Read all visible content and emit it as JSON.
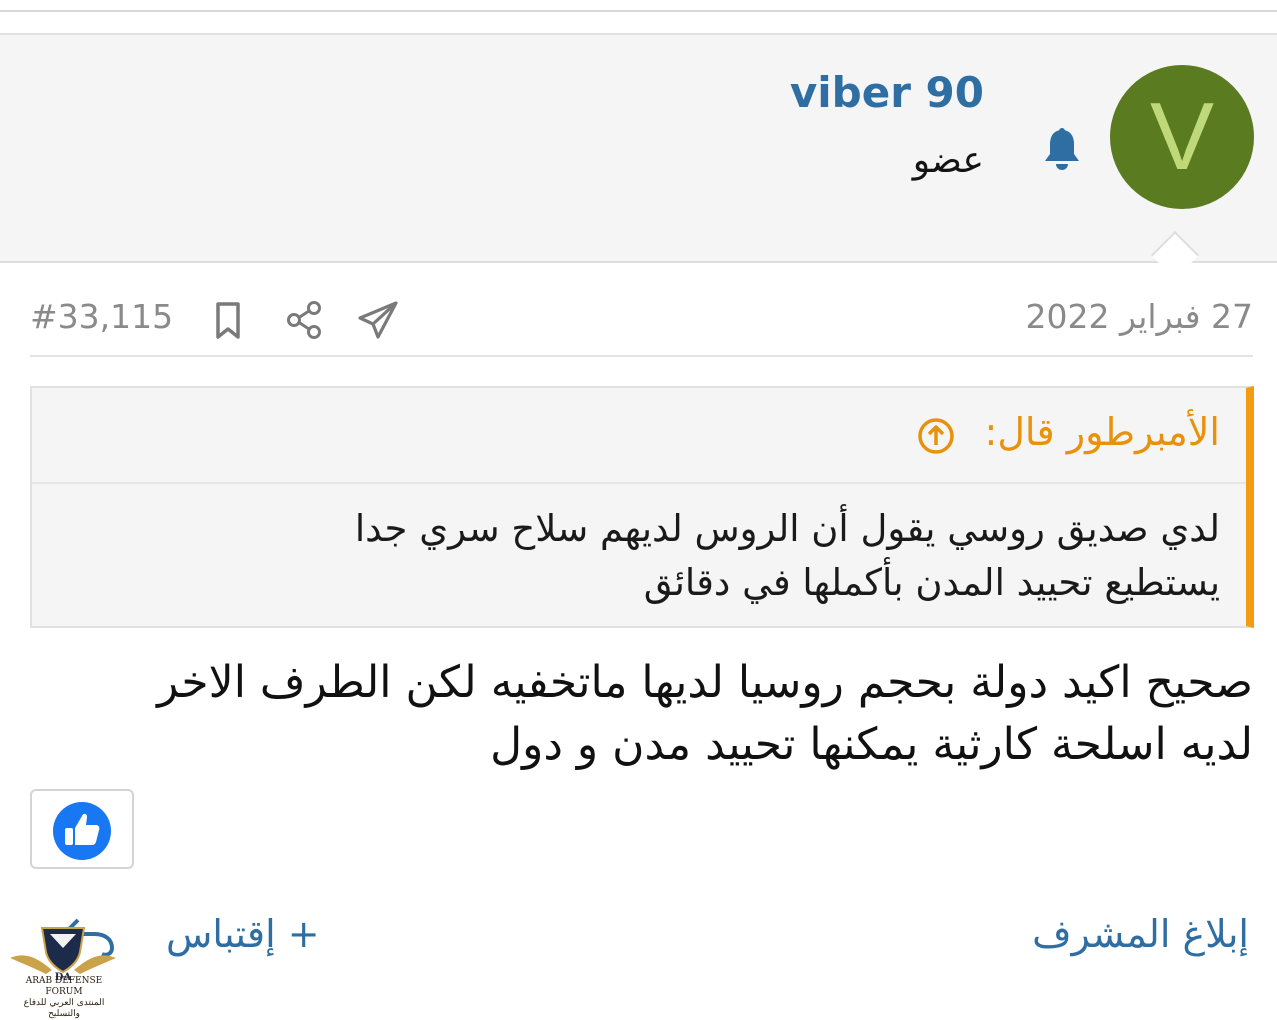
{
  "user": {
    "avatar_letter": "V",
    "avatar_color": "#5a7b1f",
    "name": "viber 90",
    "title": "عضو",
    "notify_icon": "bell-icon"
  },
  "post": {
    "date": "27 فبراير 2022",
    "number": "#33,115",
    "icons": [
      "share-telegram-icon",
      "share-icon",
      "bookmark-icon"
    ]
  },
  "quote": {
    "author": "الأمبرطور قال:",
    "lines": [
      "لدي صديق روسي يقول أن الروس لديهم سلاح سري جدا",
      "يستطيع تحييد المدن بأكملها في دقائق"
    ]
  },
  "body": {
    "lines": [
      "صحيح اكيد دولة بحجم روسيا لديها ماتخفيه لكن الطرف الاخر",
      "لديه اسلحة كارثية يمكنها تحييد مدن و دول"
    ]
  },
  "reaction": {
    "icon": "thumbs-up-icon",
    "color": "#1877f2"
  },
  "actions": {
    "report": "إبلاغ المشرف",
    "quote": "+ إقتباس"
  },
  "logo": {
    "line1": "ARAB DEFENSE FORUM",
    "line2": "المنتدى العربي للدفاع والتسليح"
  }
}
